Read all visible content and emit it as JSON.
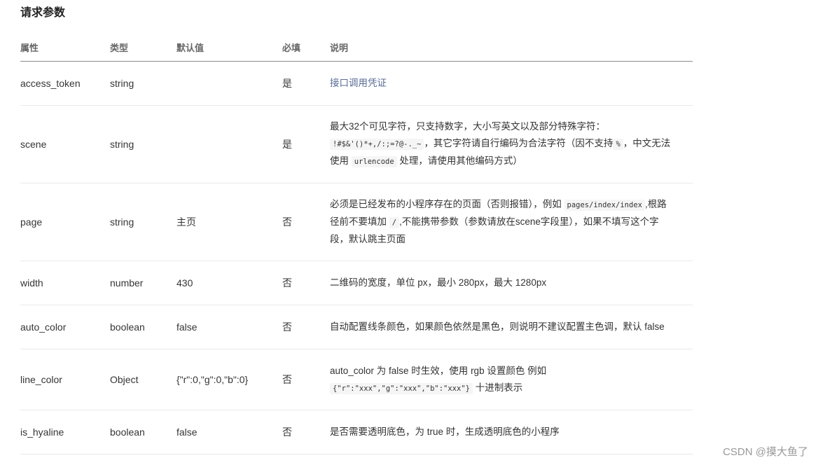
{
  "section_title": "请求参数",
  "headers": [
    "属性",
    "类型",
    "默认值",
    "必填",
    "说明"
  ],
  "rows": [
    {
      "name": "access_token",
      "type": "string",
      "default": "",
      "required": "是",
      "desc": [
        {
          "t": "text",
          "v": "接口调用凭证"
        }
      ]
    },
    {
      "name": "scene",
      "type": "string",
      "default": "",
      "required": "是",
      "desc": [
        {
          "t": "text",
          "v": "最大32个可见字符，只支持数字，大小写英文以及部分特殊字符："
        },
        {
          "t": "br"
        },
        {
          "t": "code",
          "v": "!#$&'()*+,/:;=?@-._~"
        },
        {
          "t": "text",
          "v": "，其它字符请自行编码为合法字符（因不支持"
        },
        {
          "t": "code",
          "v": "%"
        },
        {
          "t": "text",
          "v": "，中文无法"
        },
        {
          "t": "br"
        },
        {
          "t": "text",
          "v": "使用 "
        },
        {
          "t": "code",
          "v": "urlencode"
        },
        {
          "t": "text",
          "v": " 处理，请使用其他编码方式）"
        }
      ]
    },
    {
      "name": "page",
      "type": "string",
      "default": "主页",
      "required": "否",
      "desc": [
        {
          "t": "text",
          "v": "必须是已经发布的小程序存在的页面（否则报错），例如 "
        },
        {
          "t": "code",
          "v": "pages/index/index"
        },
        {
          "t": "text",
          "v": ",根路"
        },
        {
          "t": "br"
        },
        {
          "t": "text",
          "v": "径前不要填加 "
        },
        {
          "t": "code",
          "v": "/"
        },
        {
          "t": "text",
          "v": ",不能携带参数（参数请放在scene字段里），如果不填写这个字"
        },
        {
          "t": "br"
        },
        {
          "t": "text",
          "v": "段，默认跳主页面"
        }
      ]
    },
    {
      "name": "width",
      "type": "number",
      "default": "430",
      "required": "否",
      "desc": [
        {
          "t": "text",
          "v": "二维码的宽度，单位 px，最小 280px，最大 1280px"
        }
      ]
    },
    {
      "name": "auto_color",
      "type": "boolean",
      "default": "false",
      "required": "否",
      "desc": [
        {
          "t": "text",
          "v": "自动配置线条颜色，如果颜色依然是黑色，则说明不建议配置主色调，默认 false"
        }
      ]
    },
    {
      "name": "line_color",
      "type": "Object",
      "default": "{\"r\":0,\"g\":0,\"b\":0}",
      "required": "否",
      "desc": [
        {
          "t": "text",
          "v": "auto_color 为 false 时生效，使用 rgb 设置颜色 例如"
        },
        {
          "t": "br"
        },
        {
          "t": "code",
          "v": "{\"r\":\"xxx\",\"g\":\"xxx\",\"b\":\"xxx\"}"
        },
        {
          "t": "text",
          "v": " 十进制表示"
        }
      ]
    },
    {
      "name": "is_hyaline",
      "type": "boolean",
      "default": "false",
      "required": "否",
      "desc": [
        {
          "t": "text",
          "v": "是否需要透明底色，为 true 时，生成透明底色的小程序"
        }
      ]
    }
  ],
  "watermark": "CSDN @摸大鱼了",
  "colors": {
    "link": "#576b95",
    "header_rule": "#8c8c8c",
    "row_rule": "#e9e9e9"
  }
}
